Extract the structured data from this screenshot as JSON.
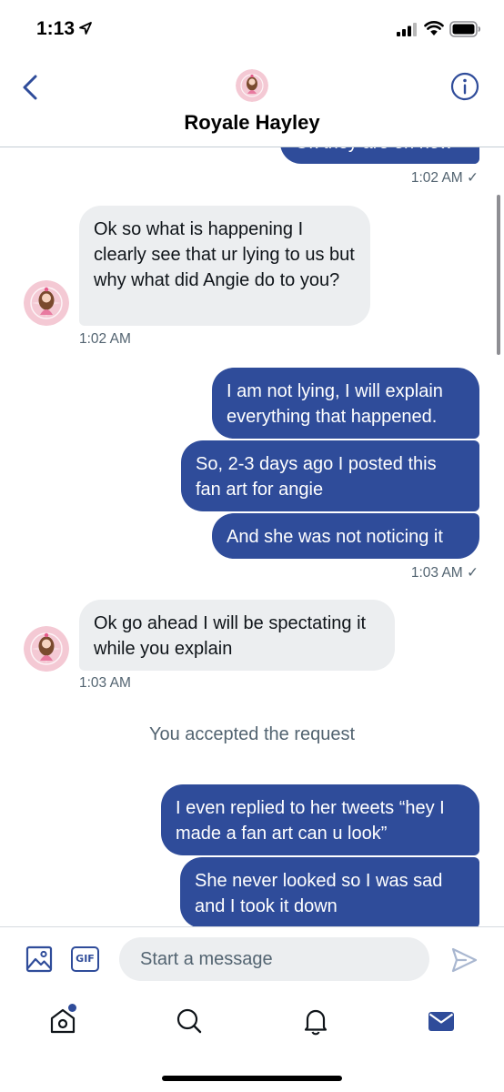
{
  "status_bar": {
    "time": "1:13"
  },
  "header": {
    "title": "Royale Hayley"
  },
  "messages": {
    "m0": "Ok they are on now",
    "ts0": "1:02 AM ✓",
    "m1": "Ok so what is happening I clearly see that ur lying to us but why what did Angie do to you?",
    "ts1": "1:02 AM",
    "m2": "I am not lying, I will explain everything that happened.",
    "m3": "So, 2-3 days ago I posted this fan art for angie",
    "m4": "And she was not noticing it",
    "ts2": "1:03 AM ✓",
    "m5": "Ok go ahead I will be spectating it while you explain",
    "ts3": "1:03 AM",
    "system": "You accepted the request",
    "m6": "I even replied to her tweets “hey I made a fan art can u look”",
    "m7": "She never looked so I was sad and I took it down"
  },
  "composer": {
    "placeholder": "Start a message",
    "gif_label": "GIF"
  },
  "colors": {
    "accent": "#2f4c9a",
    "incoming_bubble": "#eceef0",
    "muted_text": "#536471"
  },
  "icons": [
    "location-arrow-icon",
    "signal-icon",
    "wifi-icon",
    "battery-icon",
    "back-chevron-icon",
    "info-icon",
    "image-icon",
    "send-icon",
    "home-icon",
    "search-icon",
    "bell-icon",
    "mail-icon"
  ]
}
